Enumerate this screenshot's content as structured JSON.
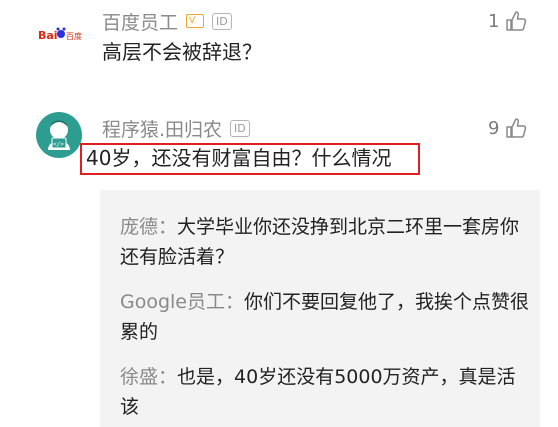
{
  "comments": [
    {
      "author": "百度员工",
      "badge_v": "V",
      "badge_id": "ID",
      "text": "高层不会被辞退？",
      "likes": "1",
      "avatar": "baidu-logo"
    },
    {
      "author": "程序猿.田归农",
      "badge_id": "ID",
      "text": "40岁，还没有财富自由？什么情况",
      "likes": "9",
      "avatar": "developer-avatar"
    }
  ],
  "replies": [
    {
      "author": "庞德：",
      "text": "大学毕业你还没挣到北京二环里一套房你还有脸活着？"
    },
    {
      "author": "Google员工：",
      "text": "你们不要回复他了，我挨个点赞很累的"
    },
    {
      "author": "徐盛：",
      "text": "也是，40岁还没有5000万资产，真是活该"
    }
  ],
  "colors": {
    "highlight": "#e02020",
    "baidu_red": "#de2910",
    "baidu_blue": "#2932e1",
    "avatar_bg": "#2d9c91",
    "reply_bg": "#f3f3f3"
  }
}
